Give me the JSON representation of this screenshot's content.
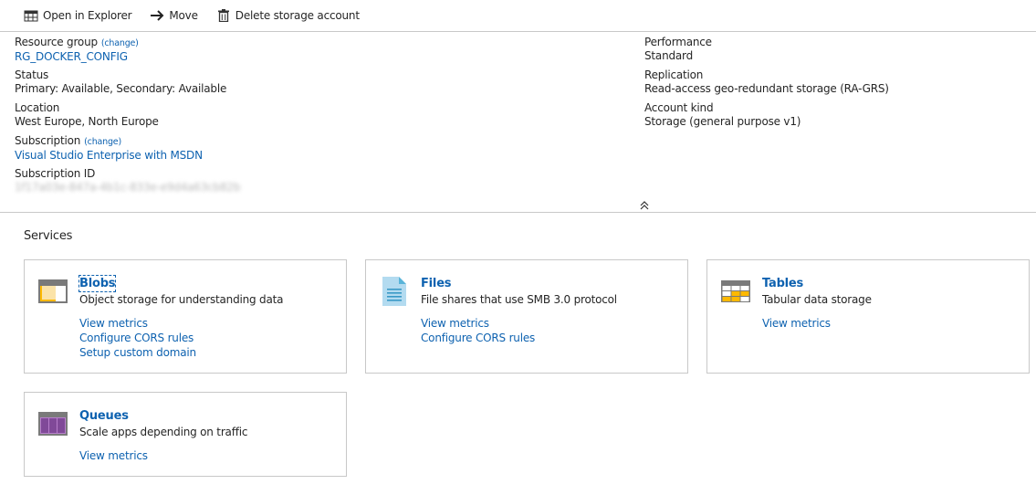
{
  "toolbar": {
    "open_explorer": "Open in Explorer",
    "move": "Move",
    "delete": "Delete storage account"
  },
  "essentials": {
    "left": {
      "resource_group": {
        "label": "Resource group",
        "change": "(change)",
        "value": "RG_DOCKER_CONFIG"
      },
      "status": {
        "label": "Status",
        "value": "Primary: Available, Secondary: Available"
      },
      "location": {
        "label": "Location",
        "value": "West Europe, North Europe"
      },
      "subscription": {
        "label": "Subscription",
        "change": "(change)",
        "value": "Visual Studio Enterprise with MSDN"
      },
      "subscription_id": {
        "label": "Subscription ID",
        "value": "1f17a03e-847a-4b1c-833e-e9d4a63cb82b"
      }
    },
    "right": {
      "performance": {
        "label": "Performance",
        "value": "Standard"
      },
      "replication": {
        "label": "Replication",
        "value": "Read-access geo-redundant storage (RA-GRS)"
      },
      "account_kind": {
        "label": "Account kind",
        "value": "Storage (general purpose v1)"
      }
    }
  },
  "services": {
    "title": "Services",
    "cards": [
      {
        "title": "Blobs",
        "description": "Object storage for understanding data",
        "links": [
          "View metrics",
          "Configure CORS rules",
          "Setup custom domain"
        ],
        "icon": "blob-icon"
      },
      {
        "title": "Files",
        "description": "File shares that use SMB 3.0 protocol",
        "links": [
          "View metrics",
          "Configure CORS rules"
        ],
        "icon": "file-icon"
      },
      {
        "title": "Tables",
        "description": "Tabular data storage",
        "links": [
          "View metrics"
        ],
        "icon": "table-icon"
      },
      {
        "title": "Queues",
        "description": "Scale apps depending on traffic",
        "links": [
          "View metrics"
        ],
        "icon": "queue-icon"
      }
    ]
  },
  "colors": {
    "link": "#0e62b0",
    "border": "#c8c8c8",
    "blob_accent": "#ffb900",
    "file_accent": "#3999c6",
    "table_accent": "#ffb900",
    "queue_accent": "#804998"
  }
}
